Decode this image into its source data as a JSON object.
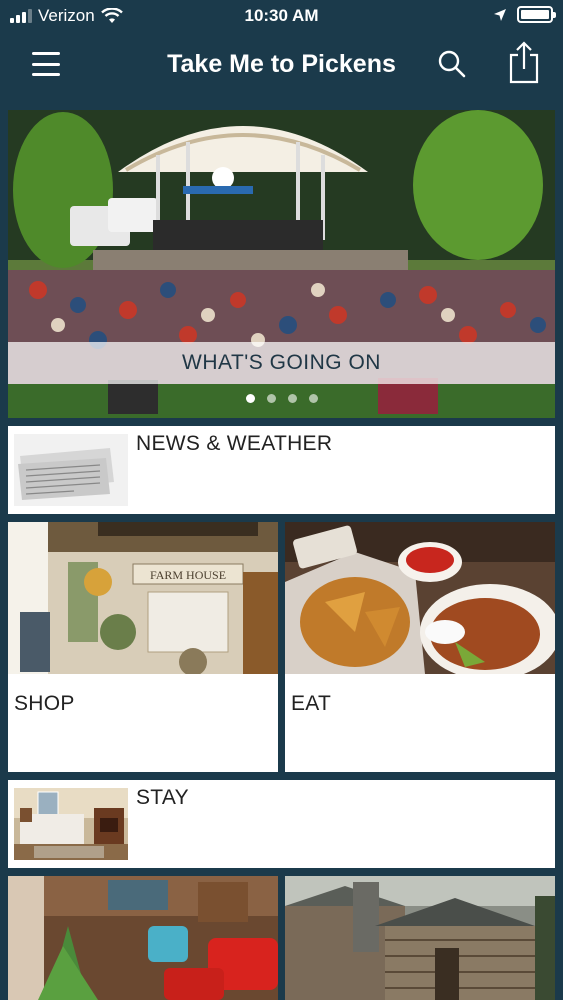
{
  "status_bar": {
    "carrier": "Verizon",
    "time": "10:30 AM",
    "wifi_icon": "wifi-icon",
    "location_icon": "location-arrow-icon",
    "battery_icon": "battery-icon"
  },
  "nav": {
    "title": "Take Me to Pickens",
    "menu_icon": "hamburger-menu-icon",
    "search_icon": "search-icon",
    "share_icon": "share-icon"
  },
  "tiles": {
    "hero": {
      "label": "WHAT'S GOING ON",
      "pager_active": 1,
      "pager_count": 4
    },
    "news": {
      "label": "NEWS & WEATHER"
    },
    "shop": {
      "label": "SHOP"
    },
    "eat": {
      "label": "EAT"
    },
    "stay": {
      "label": "STAY"
    }
  },
  "colors": {
    "background": "#1b3a4b",
    "tile": "#ffffff",
    "banner_text": "#203746"
  }
}
